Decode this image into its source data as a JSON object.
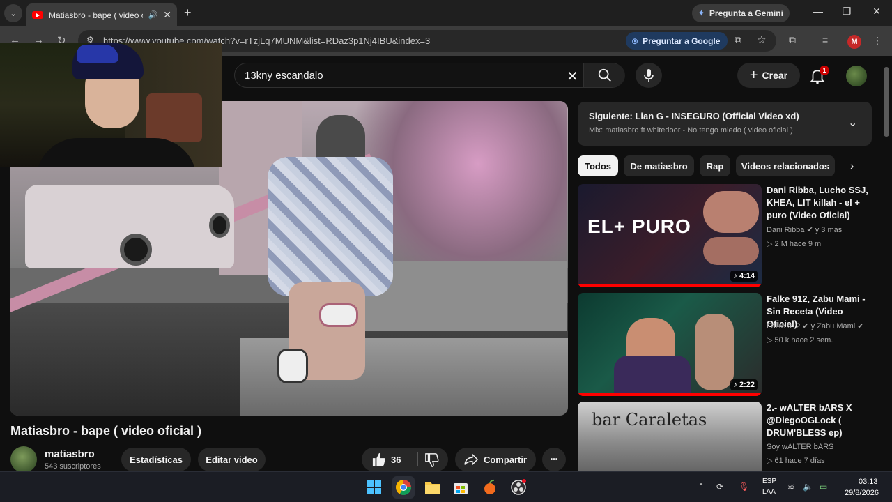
{
  "browser": {
    "tab_title": "Matiasbro - bape ( video oficial )",
    "new_tab_symbol": "+",
    "gemini_label": "Pregunta a Gemini",
    "url": "https://www.youtube.com/watch?v=rTzjLq7MUNM&list=RDaz3p1Nj4IBU&index=3",
    "ask_google_label": "Preguntar a Google",
    "profile_initial": "M"
  },
  "youtube": {
    "search_query": "13kny escandalo",
    "create_label": "Crear",
    "notification_count": "1"
  },
  "video": {
    "title": "Matiasbro - bape ( video oficial )",
    "channel": "matiasbro",
    "subscribers": "543 suscriptores",
    "stats_label": "Estadísticas",
    "edit_label": "Editar video",
    "likes": "36",
    "share_label": "Compartir",
    "more_symbol": "•••"
  },
  "up_next": {
    "title": "Siguiente: Lian G - INSEGURO (Official Video xd)",
    "subtitle": "Mix: matiasbro ft whitedoor - No tengo miedo ( video oficial )"
  },
  "chips": [
    "Todos",
    "De matiasbro",
    "Rap",
    "Videos relacionados"
  ],
  "recommendations": [
    {
      "title": "Dani Ribba, Lucho SSJ, KHEA, LIT killah - el + puro (Video Oficial)",
      "channel": "Dani Ribba ✔ y 3 más",
      "meta": "▷ 2 M  hace 9 m",
      "duration": "♪ 4:14",
      "thumb_text": "EL+ PURO"
    },
    {
      "title": "Falke 912, Zabu Mami - Sin Receta (Video Oficial)",
      "channel": "Falke 912 ✔ y Zabu Mami ✔",
      "meta": "▷ 50 k  hace 2 sem.",
      "duration": "♪ 2:22",
      "thumb_text": ""
    },
    {
      "title": "2.- wALTER bARS X @DiegoOGLock ( DRUM'BLESS ep)",
      "channel": "Soy wALTER bARS",
      "meta": "▷ 61  hace 7 días",
      "duration": "",
      "thumb_text": "bar Caraletas"
    }
  ],
  "taskbar": {
    "lang_line1": "ESP",
    "lang_line2": "LAA",
    "time": "03:13",
    "date": "29/8/2026"
  }
}
